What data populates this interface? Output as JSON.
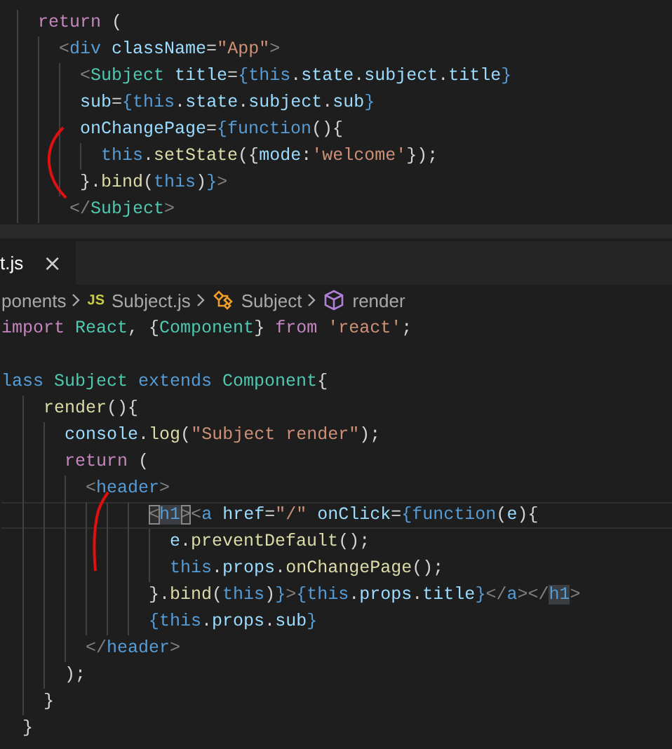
{
  "top_editor": {
    "lines": [
      {
        "current": false,
        "tokens": [
          {
            "kind": "kw",
            "text": "    return"
          },
          {
            "kind": "p",
            "text": " ("
          }
        ]
      },
      {
        "current": false,
        "tokens": [
          {
            "kind": "ang",
            "text": "      <"
          },
          {
            "kind": "blue",
            "text": "div"
          },
          {
            "kind": "attr",
            "text": " className"
          },
          {
            "kind": "p",
            "text": "="
          },
          {
            "kind": "str",
            "text": "\"App\""
          },
          {
            "kind": "ang",
            "text": ">"
          }
        ]
      },
      {
        "current": false,
        "tokens": [
          {
            "kind": "ang",
            "text": "        <"
          },
          {
            "kind": "tag",
            "text": "Subject"
          },
          {
            "kind": "attr",
            "text": " title"
          },
          {
            "kind": "p",
            "text": "="
          },
          {
            "kind": "blue",
            "text": "{this"
          },
          {
            "kind": "p",
            "text": "."
          },
          {
            "kind": "attr",
            "text": "state"
          },
          {
            "kind": "p",
            "text": "."
          },
          {
            "kind": "attr",
            "text": "subject"
          },
          {
            "kind": "p",
            "text": "."
          },
          {
            "kind": "attr",
            "text": "title"
          },
          {
            "kind": "blue",
            "text": "}"
          }
        ]
      },
      {
        "current": false,
        "tokens": [
          {
            "kind": "attr",
            "text": "        sub"
          },
          {
            "kind": "p",
            "text": "="
          },
          {
            "kind": "blue",
            "text": "{this"
          },
          {
            "kind": "p",
            "text": "."
          },
          {
            "kind": "attr",
            "text": "state"
          },
          {
            "kind": "p",
            "text": "."
          },
          {
            "kind": "attr",
            "text": "subject"
          },
          {
            "kind": "p",
            "text": "."
          },
          {
            "kind": "attr",
            "text": "sub"
          },
          {
            "kind": "blue",
            "text": "}"
          }
        ]
      },
      {
        "current": false,
        "tokens": [
          {
            "kind": "attr",
            "text": "        onChangePage"
          },
          {
            "kind": "p",
            "text": "="
          },
          {
            "kind": "blue",
            "text": "{function"
          },
          {
            "kind": "p",
            "text": "(){"
          }
        ]
      },
      {
        "current": false,
        "tokens": [
          {
            "kind": "blue",
            "text": "          this"
          },
          {
            "kind": "p",
            "text": "."
          },
          {
            "kind": "fn",
            "text": "setState"
          },
          {
            "kind": "p",
            "text": "({"
          },
          {
            "kind": "attr",
            "text": "mode"
          },
          {
            "kind": "p",
            "text": ":"
          },
          {
            "kind": "str",
            "text": "'welcome'"
          },
          {
            "kind": "p",
            "text": "});"
          }
        ]
      },
      {
        "current": false,
        "tokens": [
          {
            "kind": "p",
            "text": "        }."
          },
          {
            "kind": "fn",
            "text": "bind"
          },
          {
            "kind": "p",
            "text": "("
          },
          {
            "kind": "blue",
            "text": "this"
          },
          {
            "kind": "p",
            "text": ")"
          },
          {
            "kind": "blue",
            "text": "}"
          },
          {
            "kind": "ang",
            "text": ">"
          }
        ]
      },
      {
        "current": false,
        "tokens": [
          {
            "kind": "ang",
            "text": "       </"
          },
          {
            "kind": "tag",
            "text": "Subject"
          },
          {
            "kind": "ang",
            "text": ">"
          }
        ]
      }
    ]
  },
  "tabs": [
    {
      "label": "t.js",
      "close": "×",
      "selected": true
    }
  ],
  "breadcrumb": [
    {
      "kind": "folder",
      "label": "ponents"
    },
    {
      "kind": "js",
      "badge": "JS",
      "label": "Subject.js"
    },
    {
      "kind": "class",
      "label": "Subject"
    },
    {
      "kind": "method",
      "label": "render"
    }
  ],
  "bottom_editor": {
    "lines": [
      {
        "current": false,
        "tokens": [
          {
            "kind": "kw",
            "text": "import"
          },
          {
            "kind": "tag",
            "text": " React"
          },
          {
            "kind": "p",
            "text": ", {"
          },
          {
            "kind": "tag",
            "text": "Component"
          },
          {
            "kind": "p",
            "text": "}"
          },
          {
            "kind": "kw",
            "text": " from"
          },
          {
            "kind": "str",
            "text": " 'react'"
          },
          {
            "kind": "p",
            "text": ";"
          }
        ]
      },
      {
        "current": false
      },
      {
        "current": false,
        "tokens": [
          {
            "kind": "blue",
            "text": "lass"
          },
          {
            "kind": "tag",
            "text": " Subject"
          },
          {
            "kind": "blue",
            "text": " extends"
          },
          {
            "kind": "tag",
            "text": " Component"
          },
          {
            "kind": "p",
            "text": "{"
          }
        ]
      },
      {
        "current": false,
        "tokens": [
          {
            "kind": "fn",
            "text": "    render"
          },
          {
            "kind": "p",
            "text": "(){"
          }
        ]
      },
      {
        "current": false,
        "tokens": [
          {
            "kind": "attr",
            "text": "      console"
          },
          {
            "kind": "p",
            "text": "."
          },
          {
            "kind": "fn",
            "text": "log"
          },
          {
            "kind": "p",
            "text": "("
          },
          {
            "kind": "str",
            "text": "\"Subject render\""
          },
          {
            "kind": "p",
            "text": ");"
          }
        ]
      },
      {
        "current": false,
        "tokens": [
          {
            "kind": "kw",
            "text": "      return"
          },
          {
            "kind": "p",
            "text": " ("
          }
        ]
      },
      {
        "current": false,
        "tokens": [
          {
            "kind": "ang",
            "text": "        <"
          },
          {
            "kind": "blue",
            "text": "header"
          },
          {
            "kind": "ang",
            "text": ">"
          }
        ]
      },
      {
        "current": true,
        "tokens": [
          {
            "kind": "bracket",
            "text": "              <"
          },
          {
            "kind": "hl",
            "text": "h1"
          },
          {
            "kind": "bracket",
            "text": ">"
          },
          {
            "kind": "ang",
            "text": "<"
          },
          {
            "kind": "blue",
            "text": "a"
          },
          {
            "kind": "attr",
            "text": " href"
          },
          {
            "kind": "p",
            "text": "="
          },
          {
            "kind": "str",
            "text": "\"/\""
          },
          {
            "kind": "attr",
            "text": " onClick"
          },
          {
            "kind": "p",
            "text": "="
          },
          {
            "kind": "blue",
            "text": "{function"
          },
          {
            "kind": "p",
            "text": "("
          },
          {
            "kind": "attr",
            "text": "e"
          },
          {
            "kind": "p",
            "text": "){"
          }
        ]
      },
      {
        "current": false,
        "tokens": [
          {
            "kind": "attr",
            "text": "                e"
          },
          {
            "kind": "p",
            "text": "."
          },
          {
            "kind": "fn",
            "text": "preventDefault"
          },
          {
            "kind": "p",
            "text": "();"
          }
        ]
      },
      {
        "current": false,
        "tokens": [
          {
            "kind": "blue",
            "text": "                this"
          },
          {
            "kind": "p",
            "text": "."
          },
          {
            "kind": "attr",
            "text": "props"
          },
          {
            "kind": "p",
            "text": "."
          },
          {
            "kind": "fn",
            "text": "onChangePage"
          },
          {
            "kind": "p",
            "text": "();"
          }
        ]
      },
      {
        "current": false,
        "tokens": [
          {
            "kind": "p",
            "text": "              }."
          },
          {
            "kind": "fn",
            "text": "bind"
          },
          {
            "kind": "p",
            "text": "("
          },
          {
            "kind": "blue",
            "text": "this"
          },
          {
            "kind": "p",
            "text": ")"
          },
          {
            "kind": "blue",
            "text": "}"
          },
          {
            "kind": "ang",
            "text": ">"
          },
          {
            "kind": "blue",
            "text": "{this"
          },
          {
            "kind": "p",
            "text": "."
          },
          {
            "kind": "attr",
            "text": "props"
          },
          {
            "kind": "p",
            "text": "."
          },
          {
            "kind": "attr",
            "text": "title"
          },
          {
            "kind": "blue",
            "text": "}"
          },
          {
            "kind": "ang",
            "text": "</"
          },
          {
            "kind": "blue",
            "text": "a"
          },
          {
            "kind": "ang",
            "text": "></"
          },
          {
            "kind": "hl",
            "text": "h1"
          },
          {
            "kind": "ang",
            "text": ">"
          }
        ]
      },
      {
        "current": false,
        "tokens": [
          {
            "kind": "blue",
            "text": "              {this"
          },
          {
            "kind": "p",
            "text": "."
          },
          {
            "kind": "attr",
            "text": "props"
          },
          {
            "kind": "p",
            "text": "."
          },
          {
            "kind": "attr",
            "text": "sub"
          },
          {
            "kind": "blue",
            "text": "}"
          }
        ]
      },
      {
        "current": false,
        "tokens": [
          {
            "kind": "ang",
            "text": "        </"
          },
          {
            "kind": "blue",
            "text": "header"
          },
          {
            "kind": "ang",
            "text": ">"
          }
        ]
      },
      {
        "current": false,
        "tokens": [
          {
            "kind": "p",
            "text": "      );"
          }
        ]
      },
      {
        "current": false,
        "tokens": [
          {
            "kind": "p",
            "text": "    }"
          }
        ]
      },
      {
        "current": false,
        "tokens": [
          {
            "kind": "p",
            "text": "  }"
          }
        ]
      }
    ]
  }
}
